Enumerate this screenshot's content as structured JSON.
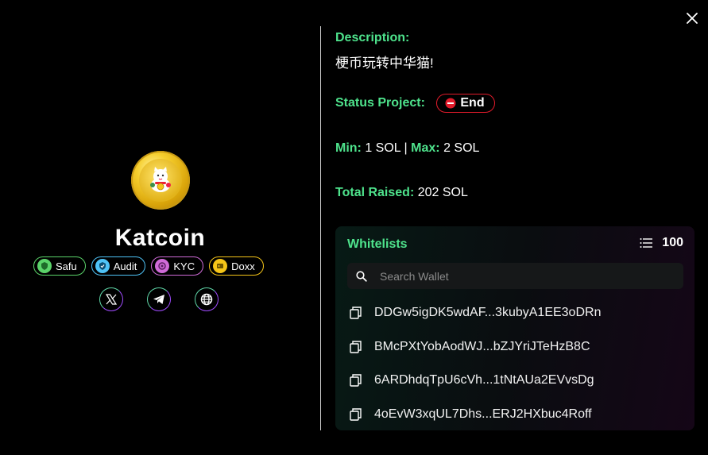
{
  "project": {
    "name": "Katcoin",
    "badges": [
      {
        "label": "Safu",
        "color": "#5bd46a"
      },
      {
        "label": "Audit",
        "color": "#4fc3f7"
      },
      {
        "label": "KYC",
        "color": "#d06bd8"
      },
      {
        "label": "Doxx",
        "color": "#f5c518"
      }
    ],
    "socials": [
      "x-icon",
      "telegram-icon",
      "globe-icon"
    ]
  },
  "details": {
    "description_label": "Description:",
    "description_text": "梗币玩转中华猫!",
    "status_label": "Status Project:",
    "status_value": "End",
    "min_label": "Min:",
    "min_value": "1 SOL",
    "separator": "|",
    "max_label": "Max:",
    "max_value": "2 SOL",
    "raised_label": "Total Raised:",
    "raised_value": "202 SOL"
  },
  "whitelist": {
    "title": "Whitelists",
    "count": "100",
    "search_placeholder": "Search Wallet",
    "wallets": [
      "DDGw5igDK5wdAF...3kubyA1EE3oDRn",
      "BMcPXtYobAodWJ...bZJYriJTeHzB8C",
      "6ARDhdqTpU6cVh...1tNtAUa2EVvsDg",
      "4oEvW3xqUL7Dhs...ERJ2HXbuc4Roff"
    ]
  },
  "colors": {
    "accent_green": "#4ee38c",
    "status_red": "#e21b2b",
    "background": "#000000"
  }
}
